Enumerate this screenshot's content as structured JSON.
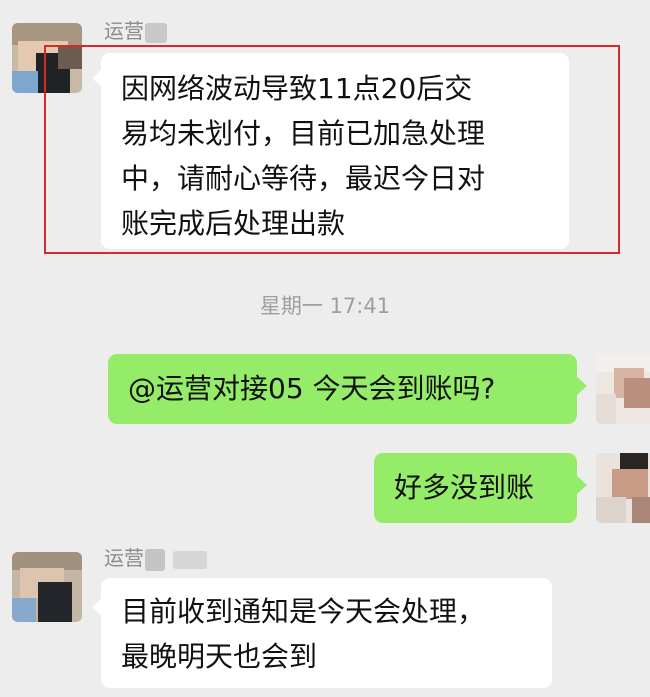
{
  "messages": [
    {
      "sender": "运营",
      "lines": [
        "因网络波动导致11点20后交",
        "易均未划付，目前已加急处理",
        "中，请耐心等待，最迟今日对",
        "账完成后处理出款"
      ]
    },
    {
      "text": "@运营对接05 今天会到账吗?"
    },
    {
      "text": "好多没到账"
    },
    {
      "sender": "运营",
      "lines": [
        "目前收到通知是今天会处理，",
        "最晚明天也会到"
      ]
    }
  ],
  "timestamp": "星期一 17:41",
  "colors": {
    "background": "#ededed",
    "incoming_bubble": "#ffffff",
    "outgoing_bubble": "#95ec69",
    "highlight_border": "#d42a2a"
  }
}
